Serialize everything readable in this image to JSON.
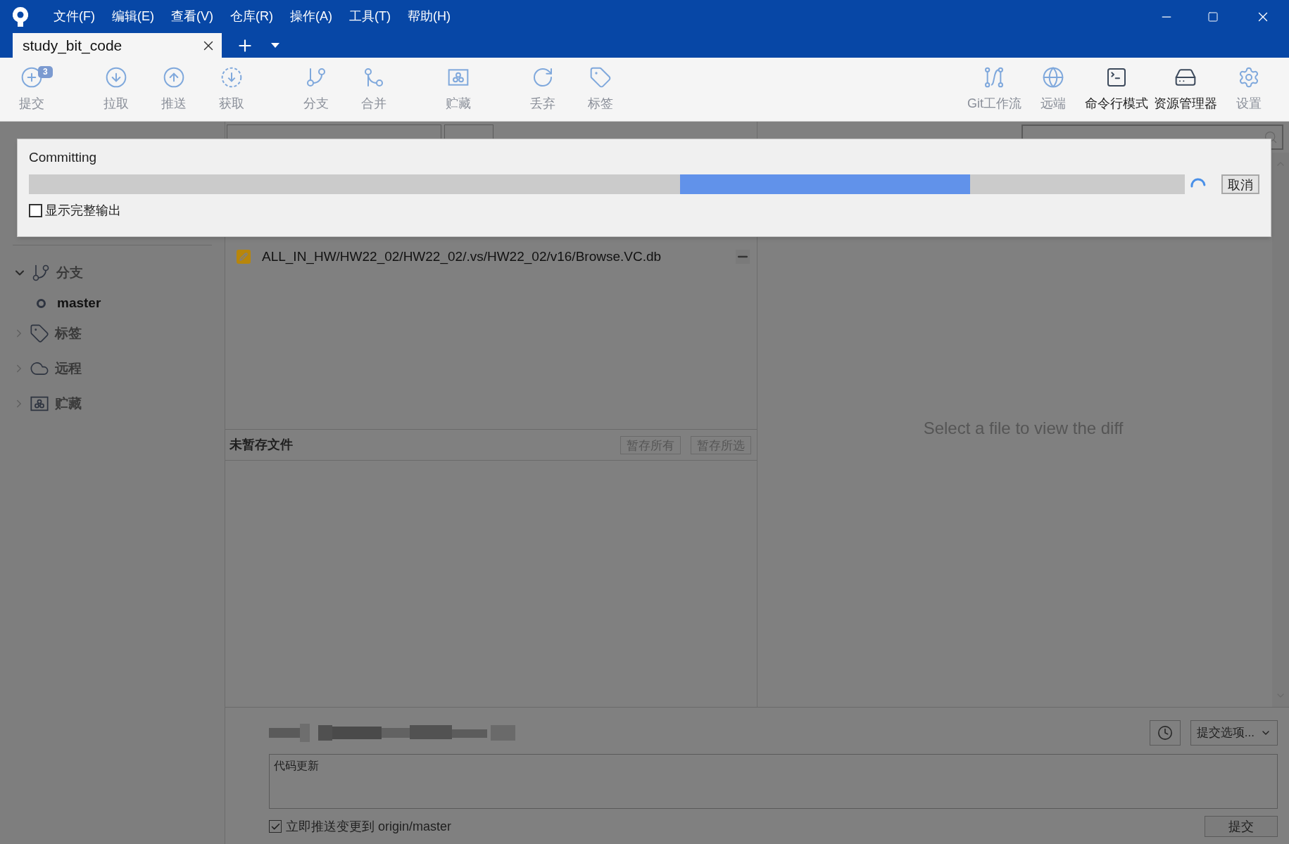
{
  "window": {
    "menu": [
      "文件(F)",
      "编辑(E)",
      "查看(V)",
      "仓库(R)",
      "操作(A)",
      "工具(T)",
      "帮助(H)"
    ],
    "tabs": [
      {
        "label": "study_bit_code",
        "selected": true
      }
    ]
  },
  "toolbar": {
    "left": [
      {
        "kind": "commit",
        "label": "提交",
        "badge": "3",
        "disabled": true,
        "gap_before": false
      },
      {
        "kind": "pull",
        "label": "拉取",
        "disabled": true,
        "gap_before": true
      },
      {
        "kind": "push",
        "label": "推送",
        "disabled": true,
        "gap_before": false
      },
      {
        "kind": "fetch",
        "label": "获取",
        "disabled": true,
        "gap_before": false
      },
      {
        "kind": "branch",
        "label": "分支",
        "disabled": true,
        "gap_before": true
      },
      {
        "kind": "merge",
        "label": "合并",
        "disabled": true,
        "gap_before": false
      },
      {
        "kind": "stash",
        "label": "贮藏",
        "disabled": true,
        "gap_before": true
      },
      {
        "kind": "discard",
        "label": "丢弃",
        "disabled": true,
        "gap_before": true
      },
      {
        "kind": "tag",
        "label": "标签",
        "disabled": true,
        "gap_before": false
      }
    ],
    "right": [
      {
        "kind": "gitflow",
        "label": "Git工作流",
        "disabled": true
      },
      {
        "kind": "remote",
        "label": "远端",
        "disabled": true
      },
      {
        "kind": "terminal",
        "label": "命令行模式",
        "disabled": false
      },
      {
        "kind": "explorer",
        "label": "资源管理器",
        "disabled": false
      },
      {
        "kind": "settings",
        "label": "设置",
        "disabled": true
      }
    ]
  },
  "sidebar": {
    "tree": [
      {
        "kind": "branch",
        "label": "分支",
        "expanded": true,
        "children": [
          {
            "label": "master",
            "current": true
          }
        ]
      },
      {
        "kind": "tag",
        "label": "标签",
        "expanded": false
      },
      {
        "kind": "remote",
        "label": "远程",
        "expanded": false
      },
      {
        "kind": "stash",
        "label": "贮藏",
        "expanded": false
      }
    ]
  },
  "staged": {
    "files": [
      {
        "path": "ALL_IN_HW/HW22_02/HW22_02/.vs/HW22_02/v16/Browse.VC.db"
      }
    ]
  },
  "unstaged": {
    "title": "未暂存文件",
    "buttons": [
      "暂存所有",
      "暂存所选"
    ]
  },
  "diff": {
    "message": "Select a file to view the diff"
  },
  "commit": {
    "message": "代码更新",
    "options": "提交选项...",
    "push_now": {
      "label": "立即推送变更到 origin/master",
      "checked": true
    },
    "submit": "提交"
  },
  "dialog": {
    "title": "Committing",
    "progress": {
      "indeterminate": true
    },
    "cancel": "取消",
    "full_output": {
      "label": "显示完整输出",
      "checked": false
    }
  }
}
